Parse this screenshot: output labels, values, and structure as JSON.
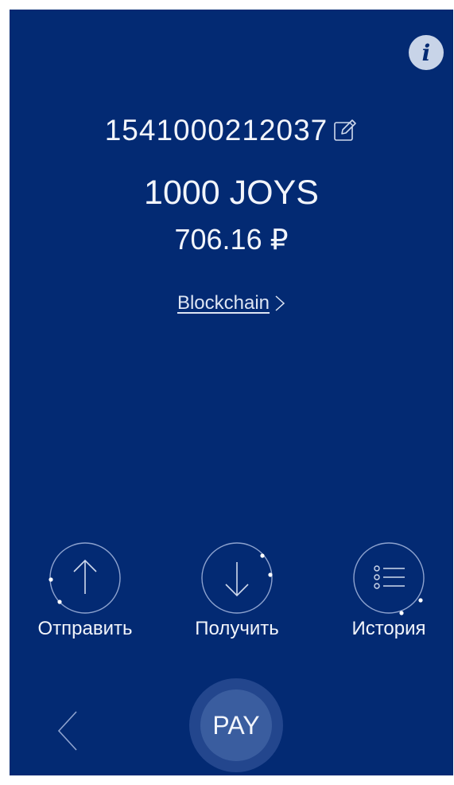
{
  "header": {
    "info_icon": "info-icon",
    "info_glyph": "i"
  },
  "wallet": {
    "account_number": "1541000212037",
    "edit_icon": "edit-icon",
    "balance": "1000 JOYS",
    "balance_fiat": "706.16 ₽",
    "blockchain_link": "Blockchain"
  },
  "actions": {
    "send_label": "Отправить",
    "receive_label": "Получить",
    "history_label": "История"
  },
  "bottom_bar": {
    "back_icon": "chevron-left-icon",
    "pay_label": "PAY"
  },
  "colors": {
    "background": "#032a73",
    "pay_button": "#3a5d9f",
    "text": "#f2f5fb"
  }
}
